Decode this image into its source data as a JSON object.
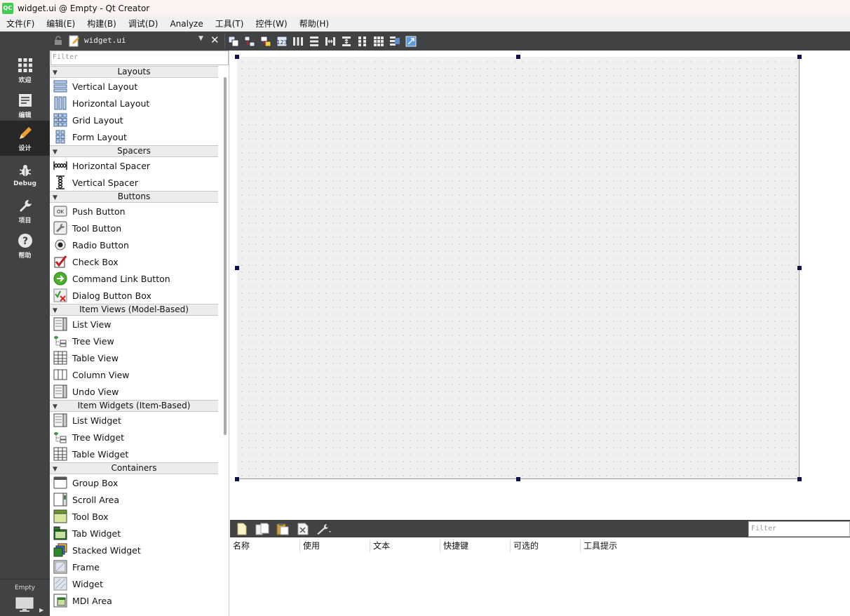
{
  "window": {
    "title": "widget.ui @ Empty - Qt Creator",
    "logo_text": "QC"
  },
  "menubar": {
    "items": [
      "文件(F)",
      "编辑(E)",
      "构建(B)",
      "调试(D)",
      "Analyze",
      "工具(T)",
      "控件(W)",
      "帮助(H)"
    ]
  },
  "modes": [
    {
      "label": "欢迎",
      "icon": "grid-icon",
      "active": false
    },
    {
      "label": "编辑",
      "icon": "document-icon",
      "active": false
    },
    {
      "label": "设计",
      "icon": "pencil-icon",
      "active": true
    },
    {
      "label": "Debug",
      "icon": "bug-icon",
      "active": false
    },
    {
      "label": "项目",
      "icon": "wrench-icon",
      "active": false
    },
    {
      "label": "帮助",
      "icon": "question-icon",
      "active": false
    }
  ],
  "target": {
    "label": "Empty",
    "icon": "monitor-icon"
  },
  "editor_toolbar": {
    "file_name": "widget.ui",
    "icons": [
      "edit-widgets-icon",
      "edit-signals-slots-icon",
      "edit-buddies-icon",
      "edit-tab-order-icon",
      "layout-horizontal-icon",
      "layout-vertical-icon",
      "layout-horizontal-splitter-icon",
      "layout-vertical-splitter-icon",
      "layout-form-icon",
      "layout-grid-icon",
      "break-layout-icon",
      "adjust-size-icon"
    ]
  },
  "widget_box": {
    "filter_placeholder": "Filter",
    "categories": [
      {
        "name": "Layouts",
        "items": [
          "Vertical Layout",
          "Horizontal Layout",
          "Grid Layout",
          "Form Layout"
        ]
      },
      {
        "name": "Spacers",
        "items": [
          "Horizontal Spacer",
          "Vertical Spacer"
        ]
      },
      {
        "name": "Buttons",
        "items": [
          "Push Button",
          "Tool Button",
          "Radio Button",
          "Check Box",
          "Command Link Button",
          "Dialog Button Box"
        ]
      },
      {
        "name": "Item Views (Model-Based)",
        "items": [
          "List View",
          "Tree View",
          "Table View",
          "Column View",
          "Undo View"
        ]
      },
      {
        "name": "Item Widgets (Item-Based)",
        "items": [
          "List Widget",
          "Tree Widget",
          "Table Widget"
        ]
      },
      {
        "name": "Containers",
        "items": [
          "Group Box",
          "Scroll Area",
          "Tool Box",
          "Tab Widget",
          "Stacked Widget",
          "Frame",
          "Widget",
          "MDI Area"
        ]
      }
    ]
  },
  "action_editor": {
    "filter_placeholder": "Filter",
    "icons": [
      "new-action-icon",
      "copy-action-icon",
      "paste-action-icon",
      "delete-action-icon",
      "configure-icon"
    ],
    "columns": [
      "名称",
      "使用",
      "文本",
      "快捷键",
      "可选的",
      "工具提示"
    ]
  },
  "colors": {
    "sidebar_bg": "#404244",
    "sidebar_active": "#262829",
    "form_bg": "#f0f0f0",
    "handle": "#101050"
  }
}
